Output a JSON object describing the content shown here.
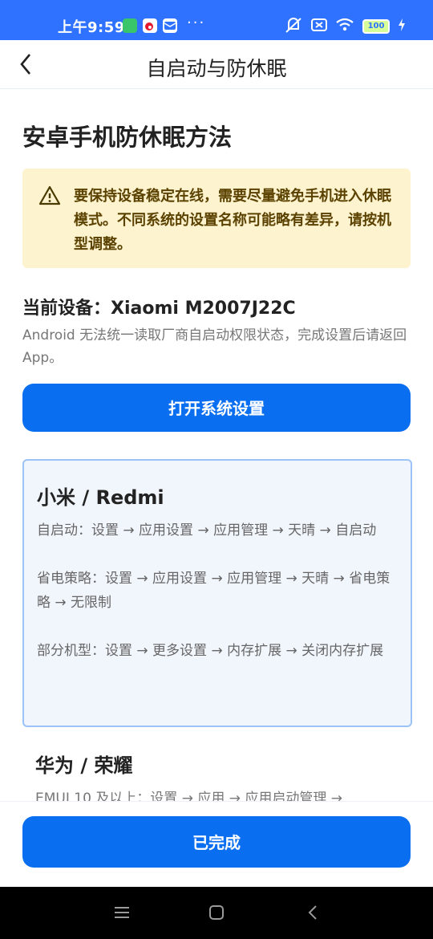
{
  "status_bar": {
    "time": "上午9:59",
    "more": "···",
    "battery": "100"
  },
  "header": {
    "title": "自启动与防休眠"
  },
  "main": {
    "heading": "安卓手机防休眠方法",
    "notice": "要保持设备稳定在线，需要尽量避免手机进入休眠模式。不同系统的设置名称可能略有差异，请按机型调整。",
    "device_label": "当前设备：Xiaomi M2007J22C",
    "device_note": "Android 无法统一读取厂商自启动权限状态，完成设置后请返回 App。",
    "open_settings_button": "打开系统设置",
    "vendors": [
      {
        "name": "小米 / Redmi",
        "steps": [
          "自启动：设置 → 应用设置 → 应用管理 → 天晴 → 自启动",
          "省电策略：设置 → 应用设置 → 应用管理 → 天晴 → 省电策略 → 无限制",
          "部分机型：设置 → 更多设置 → 内存扩展 → 关闭内存扩展"
        ]
      },
      {
        "name": "华为 / 荣耀",
        "steps": [
          "EMUI 10 及以上：设置 → 应用 → 应用启动管理 →"
        ]
      }
    ],
    "done_button": "已完成"
  },
  "icons": {
    "back": "back-arrow-icon",
    "warning": "warning-icon"
  },
  "colors": {
    "primary": "#0a6ef0",
    "status_bar": "#2e72ff",
    "notice_bg": "#fdf3cf",
    "card_bg": "#f1f6fd",
    "card_border": "#9cc3f7"
  }
}
